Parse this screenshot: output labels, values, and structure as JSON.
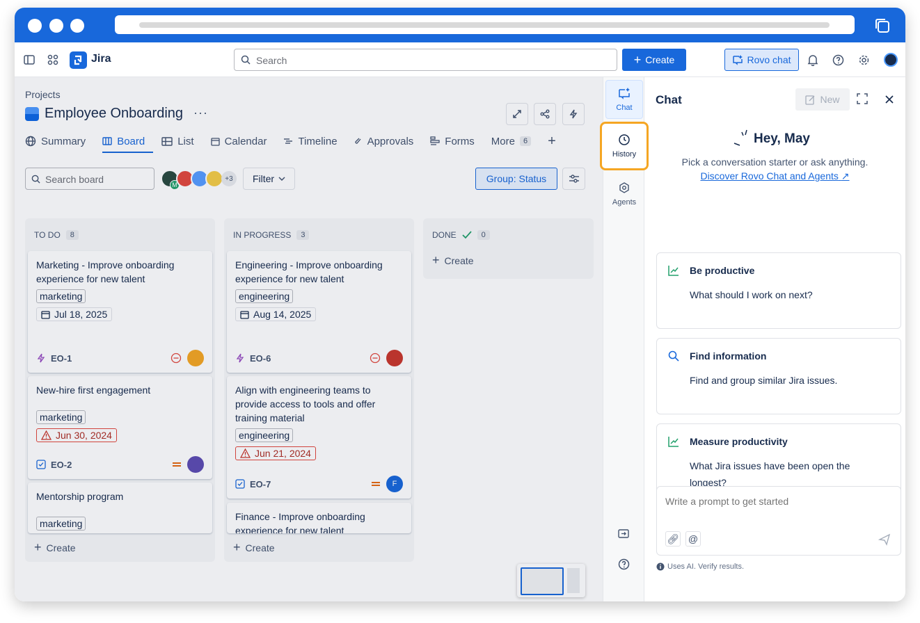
{
  "colors": {
    "accent": "#1868db",
    "highlight": "#f5a623",
    "overdue": "#ae2e24"
  },
  "nav": {
    "app_name": "Jira",
    "search_placeholder": "Search",
    "create_label": "Create",
    "rovo_label": "Rovo chat"
  },
  "project": {
    "breadcrumb": "Projects",
    "title": "Employee Onboarding",
    "more": "···"
  },
  "tabs": [
    {
      "label": "Summary",
      "icon": "globe-icon"
    },
    {
      "label": "Board",
      "icon": "board-icon",
      "active": true
    },
    {
      "label": "List",
      "icon": "list-icon"
    },
    {
      "label": "Calendar",
      "icon": "calendar-icon"
    },
    {
      "label": "Timeline",
      "icon": "timeline-icon"
    },
    {
      "label": "Approvals",
      "icon": "approvals-icon"
    },
    {
      "label": "Forms",
      "icon": "forms-icon"
    },
    {
      "label": "More",
      "count": "6"
    }
  ],
  "toolbar": {
    "search_placeholder": "Search board",
    "avatar_badge": "M",
    "more_people": "+3",
    "filter_label": "Filter",
    "group_label": "Group: Status"
  },
  "columns": [
    {
      "title": "TO DO",
      "count": "8",
      "create": "Create",
      "cards": [
        {
          "title": "Marketing - Improve onboarding experience for new talent",
          "label": "marketing",
          "date": "Jul 18, 2025",
          "overdue": false,
          "key": "EO-1",
          "type": "epic",
          "priority": "minus"
        },
        {
          "title": "New-hire first engagement",
          "label": "marketing",
          "date": "Jun 30, 2024",
          "overdue": true,
          "key": "EO-2",
          "type": "task",
          "priority": "medium"
        },
        {
          "title": "Mentorship program",
          "label": "marketing"
        }
      ]
    },
    {
      "title": "IN PROGRESS",
      "count": "3",
      "create": "Create",
      "cards": [
        {
          "title": "Engineering - Improve onboarding experience for new talent",
          "label": "engineering",
          "date": "Aug 14, 2025",
          "overdue": false,
          "key": "EO-6",
          "type": "epic",
          "priority": "minus"
        },
        {
          "title": "Align with engineering teams to provide access to tools and offer training material",
          "label": "engineering",
          "date": "Jun 21, 2024",
          "overdue": true,
          "key": "EO-7",
          "type": "task",
          "priority": "medium",
          "assignee_initial": "F"
        },
        {
          "title": "Finance - Improve onboarding experience for new talent"
        }
      ]
    },
    {
      "title": "DONE",
      "count": "0",
      "create": "Create"
    }
  ],
  "rail": {
    "chat": "Chat",
    "history": "History",
    "agents": "Agents"
  },
  "chat": {
    "title": "Chat",
    "new_label": "New",
    "greeting": "Hey, May",
    "subtitle": "Pick a conversation starter or ask anything.",
    "link": "Discover Rovo Chat and Agents",
    "starters": [
      {
        "title": "Be productive",
        "body": "What should I work on next?",
        "icon": "trend-up-icon"
      },
      {
        "title": "Find information",
        "body": "Find and group similar Jira issues.",
        "icon": "search-icon"
      },
      {
        "title": "Measure productivity",
        "body": "What Jira issues have been open the longest?",
        "icon": "trend-up-icon"
      }
    ],
    "prompt_placeholder": "Write a prompt to get started",
    "disclaimer": "Uses AI. Verify results."
  }
}
